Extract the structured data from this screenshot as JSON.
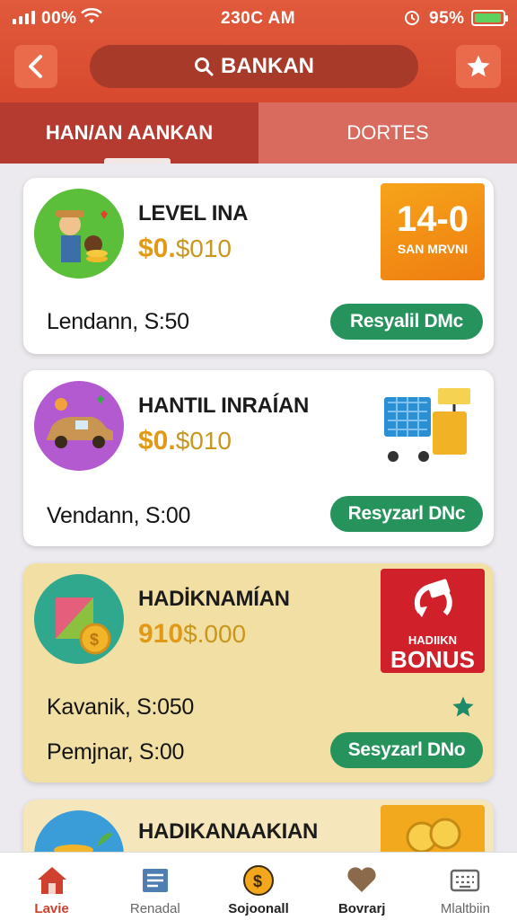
{
  "status_bar": {
    "signal_text": "00%",
    "time": "230C AM",
    "battery_text": "95%",
    "battery_level": 0.95
  },
  "header": {
    "search_label": "BANKAN",
    "back_icon": "chevron-left-icon",
    "favorite_icon": "star-icon"
  },
  "tabs": [
    {
      "label": "HAN/AN AANKAN",
      "active": true
    },
    {
      "label": "DORTES",
      "active": false
    }
  ],
  "cards": [
    {
      "title": "LEVEL INA",
      "price_main": "$0.",
      "price_rest": "$010",
      "meta": "Lendann, S:50",
      "cta": "Resyalil DMc",
      "badge_number": "14-0",
      "badge_sub": "SAN MRVNI"
    },
    {
      "title": "HANTIL INRAÍAN",
      "price_main": "$0.",
      "price_rest": "$010",
      "meta": "Vendann, S:00",
      "cta": "Resyzarl DNc"
    },
    {
      "title": "HADİKNAMÍAN",
      "price_main": "910",
      "price_rest": "$.000",
      "meta": "Kavanik, S:050",
      "meta2": "Pemjnar, S:00",
      "cta": "Sesyzarl DNo",
      "badge_sub": "HADIIKN",
      "badge_word": "BONUS"
    },
    {
      "title": "HADIKANAAKIAN"
    }
  ],
  "bottom_nav": [
    {
      "label": "Lavie",
      "icon": "home-icon"
    },
    {
      "label": "Renadal",
      "icon": "document-icon"
    },
    {
      "label": "Sojoonall",
      "icon": "coin-icon"
    },
    {
      "label": "Bovrarj",
      "icon": "heart-icon"
    },
    {
      "label": "Mlaltbiin",
      "icon": "keyboard-icon"
    }
  ],
  "colors": {
    "header": "#d8492e",
    "cta": "#26935c",
    "price": "#e29a16",
    "active_nav": "#d0402e"
  }
}
